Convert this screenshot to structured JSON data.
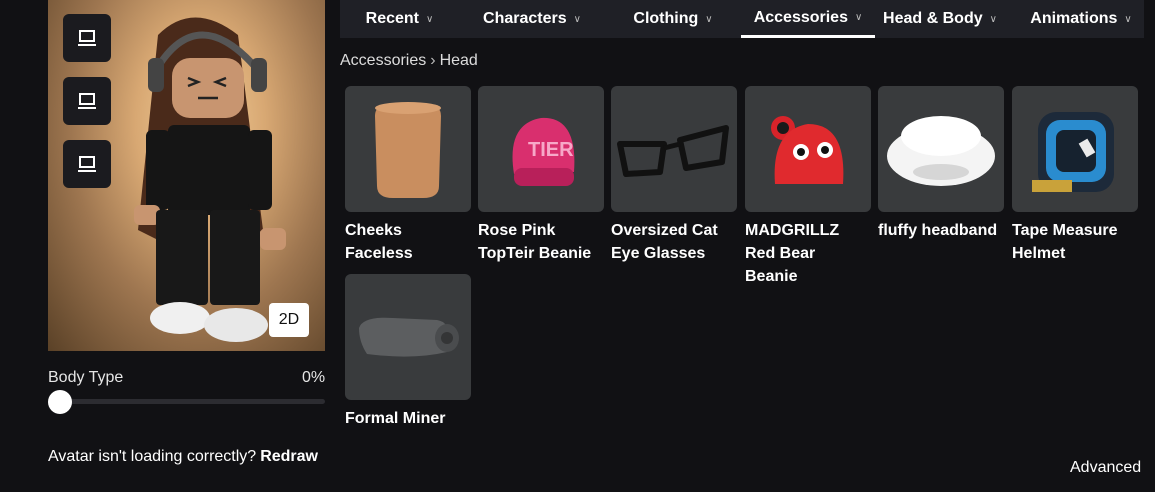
{
  "nav": {
    "tabs": [
      {
        "label": "Recent"
      },
      {
        "label": "Characters"
      },
      {
        "label": "Clothing"
      },
      {
        "label": "Accessories"
      },
      {
        "label": "Head & Body"
      },
      {
        "label": "Animations"
      }
    ],
    "active_tab": "Accessories"
  },
  "breadcrumb": {
    "parent": "Accessories",
    "current": "Head"
  },
  "preview": {
    "view_buttons": [
      "monitor-icon",
      "monitor-icon",
      "monitor-icon"
    ],
    "mode_button": "2D"
  },
  "body_type": {
    "label": "Body Type",
    "value": "0%",
    "level": 0
  },
  "reload": {
    "message": "Avatar isn't loading correctly?",
    "action": "Redraw"
  },
  "items": [
    {
      "name": "Cheeks Faceless",
      "icon": "faceless-head-icon"
    },
    {
      "name": "Rose Pink TopTeir Beanie",
      "icon": "beanie-icon"
    },
    {
      "name": "Oversized Cat Eye Glasses",
      "icon": "glasses-icon"
    },
    {
      "name": "MADGRILLZ Red Bear Beanie",
      "icon": "bear-beanie-icon"
    },
    {
      "name": "fluffy headband",
      "icon": "headband-icon"
    },
    {
      "name": "Tape Measure Helmet",
      "icon": "tape-measure-icon"
    },
    {
      "name": "Formal Miner",
      "icon": "miner-helmet-icon"
    }
  ],
  "footer": {
    "advanced": "Advanced"
  },
  "colors": {
    "background": "#111114",
    "tab_bar": "#1f2026",
    "item_tile": "#393b3d"
  }
}
